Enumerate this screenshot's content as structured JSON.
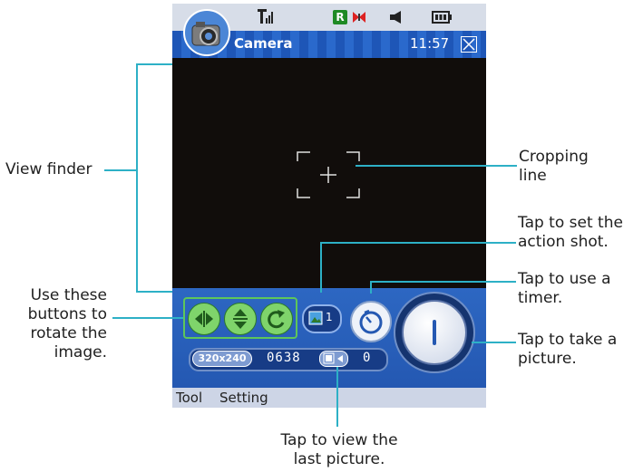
{
  "phone": {
    "title": "Camera",
    "time": "11:57",
    "menu": {
      "tool": "Tool",
      "setting": "Setting"
    },
    "resolution": "320x240",
    "shots_remaining": "0638",
    "last_picture_count": "0",
    "action_shot_count": "1"
  },
  "annotations": {
    "view_finder": "View finder",
    "cropping_line": [
      "Cropping",
      "line"
    ],
    "action_shot": [
      "Tap to set the",
      "action shot."
    ],
    "timer": [
      "Tap to use a",
      "timer."
    ],
    "rotate": [
      "Use these",
      "buttons to",
      "rotate the",
      "image."
    ],
    "take_picture": [
      "Tap to take a",
      "picture."
    ],
    "view_last": [
      "Tap to view the",
      "last picture."
    ]
  },
  "colors": {
    "accent": "#2458b2",
    "callout_line": "#2db0c6",
    "rotate_group": "#5ec65a"
  }
}
